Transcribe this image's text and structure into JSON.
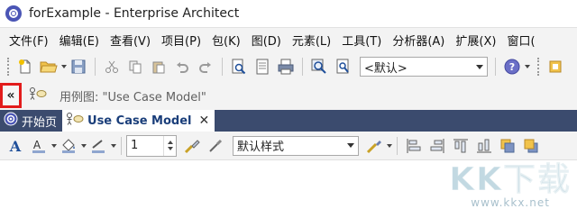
{
  "window": {
    "title": "forExample - Enterprise Architect"
  },
  "menu": [
    "文件(F)",
    "编辑(E)",
    "查看(V)",
    "项目(P)",
    "包(K)",
    "图(D)",
    "元素(L)",
    "工具(T)",
    "分析器(A)",
    "扩展(X)",
    "窗口("
  ],
  "toolbar1": {
    "view_combo_value": "<默认>"
  },
  "navbar": {
    "collapse_label": "«",
    "path": "用例图: \"Use Case Model\""
  },
  "tabs": [
    {
      "label": "开始页"
    },
    {
      "label": "Use Case Model",
      "close": "✕"
    }
  ],
  "toolbar2": {
    "line_width": "1",
    "style_combo_value": "默认样式"
  },
  "watermark": {
    "big": "KK下载",
    "small": "www.kkx.net"
  },
  "colors": {
    "tabbar_bg": "#3b4b6e",
    "highlight_border": "#e21c1c",
    "app_icon": "#4a55b5"
  }
}
